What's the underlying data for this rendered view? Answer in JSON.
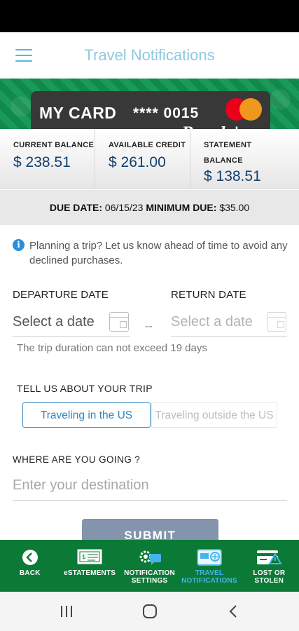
{
  "header": {
    "title": "Travel Notifications"
  },
  "card": {
    "name": "MY CARD",
    "number": "**** 0015",
    "brand": "People's"
  },
  "balances": [
    {
      "label": "CURRENT BALANCE",
      "value": "$ 238.51"
    },
    {
      "label": "AVAILABLE CREDIT",
      "value": "$ 261.00"
    },
    {
      "label": "STATEMENT BALANCE",
      "value": "$ 138.51"
    }
  ],
  "due": {
    "due_date_label": "DUE DATE:",
    "due_date": "06/15/23",
    "min_due_label": "MINIMUM DUE:",
    "min_due": "$35.00"
  },
  "info_text": "Planning a trip? Let us know ahead of time to avoid any declined purchases.",
  "departure": {
    "label": "DEPARTURE DATE",
    "placeholder": "Select a date"
  },
  "return": {
    "label": "RETURN DATE",
    "placeholder": "Select a date"
  },
  "separator": "--",
  "note": "The trip duration can not exceed 19 days",
  "trip": {
    "label": "TELL US ABOUT YOUR TRIP",
    "option_us": "Traveling in the US",
    "option_outside": "Traveling outside the US",
    "selected": "Traveling in the US"
  },
  "destination": {
    "label": "WHERE ARE YOU GOING ?",
    "placeholder": "Enter your destination"
  },
  "submit_label": "SUBMIT",
  "nav": [
    {
      "label": "BACK",
      "icon": "back-icon"
    },
    {
      "label": "eSTATEMENTS",
      "icon": "statement-icon"
    },
    {
      "label": "NOTIFICATION SETTINGS",
      "icon": "notification-settings-icon"
    },
    {
      "label": "TRAVEL NOTIFICATIONS",
      "icon": "travel-icon",
      "active": true
    },
    {
      "label": "LOST OR STOLEN",
      "icon": "lost-card-icon"
    }
  ],
  "colors": {
    "brand_green": "#0b7a37",
    "active_blue": "#45b4ec",
    "value_blue": "#123f6e"
  }
}
